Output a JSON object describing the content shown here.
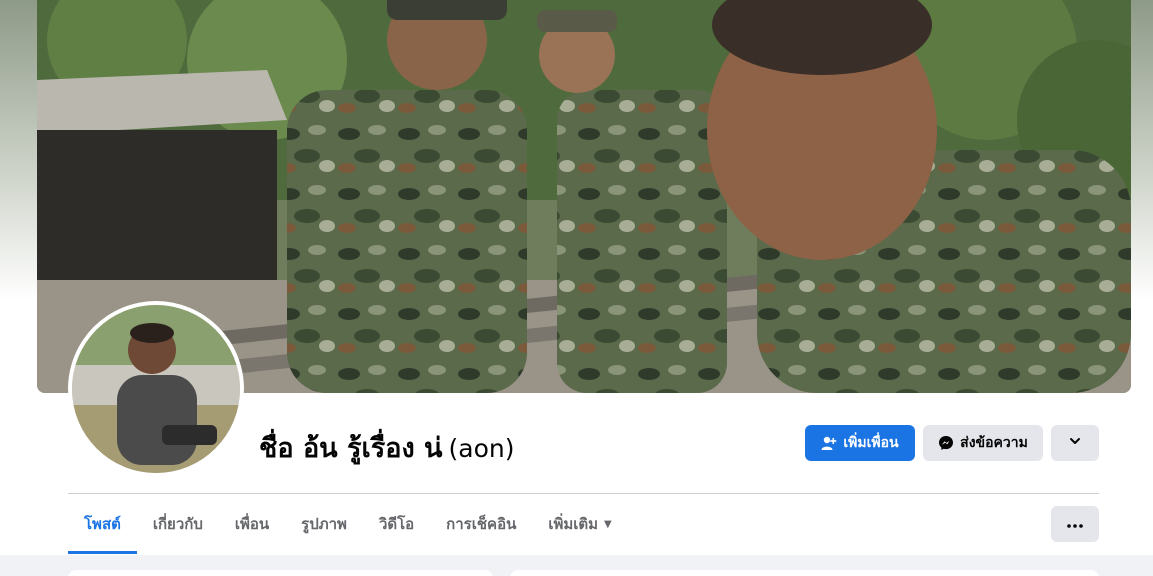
{
  "profile": {
    "name": "ชื่อ อ้น รู้เรื่อง น่",
    "alternate_name": "(aon)"
  },
  "actions": {
    "add_friend_label": "เพิ่มเพื่อน",
    "message_label": "ส่งข้อความ"
  },
  "tabs": [
    {
      "label": "โพสต์",
      "active": true
    },
    {
      "label": "เกี่ยวกับ",
      "active": false
    },
    {
      "label": "เพื่อน",
      "active": false
    },
    {
      "label": "รูปภาพ",
      "active": false
    },
    {
      "label": "วิดีโอ",
      "active": false
    },
    {
      "label": "การเช็คอิน",
      "active": false
    },
    {
      "label": "เพิ่มเติม",
      "active": false
    }
  ],
  "icons": {
    "add_friend": "person-plus-icon",
    "message": "messenger-icon",
    "dropdown": "chevron-down-icon",
    "more_tab": "caret-down-icon",
    "more_options": "ellipsis-icon"
  },
  "colors": {
    "primary": "#1b74e4",
    "secondary_button": "#e4e6eb",
    "tab_text": "#65676b",
    "page_background": "#f0f2f5"
  }
}
